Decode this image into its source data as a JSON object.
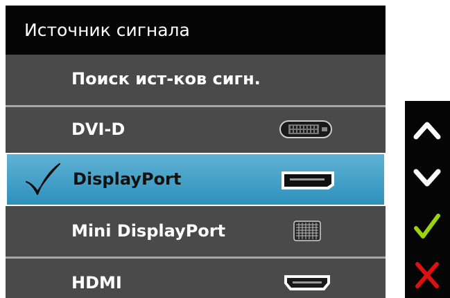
{
  "osd": {
    "title": "Источник сигнала",
    "items": [
      {
        "label": "Поиск ист-ков сигн.",
        "selected": false,
        "icon": "none"
      },
      {
        "label": "DVI-D",
        "selected": false,
        "icon": "dvi-port-icon"
      },
      {
        "label": "DisplayPort",
        "selected": true,
        "icon": "displayport-icon"
      },
      {
        "label": "Mini DisplayPort",
        "selected": false,
        "icon": "mini-displayport-icon"
      },
      {
        "label": "HDMI",
        "selected": false,
        "icon": "hdmi-port-icon"
      }
    ],
    "colors": {
      "panel_background": "#4a4a4a",
      "title_background": "#050505",
      "selected_background": "#3fa0c8",
      "check_green": "#9bd30f",
      "close_red": "#e01010"
    }
  },
  "side_buttons": [
    {
      "name": "up",
      "icon": "chevron-up-icon"
    },
    {
      "name": "down",
      "icon": "chevron-down-icon"
    },
    {
      "name": "confirm",
      "icon": "check-icon"
    },
    {
      "name": "close",
      "icon": "close-icon"
    }
  ]
}
